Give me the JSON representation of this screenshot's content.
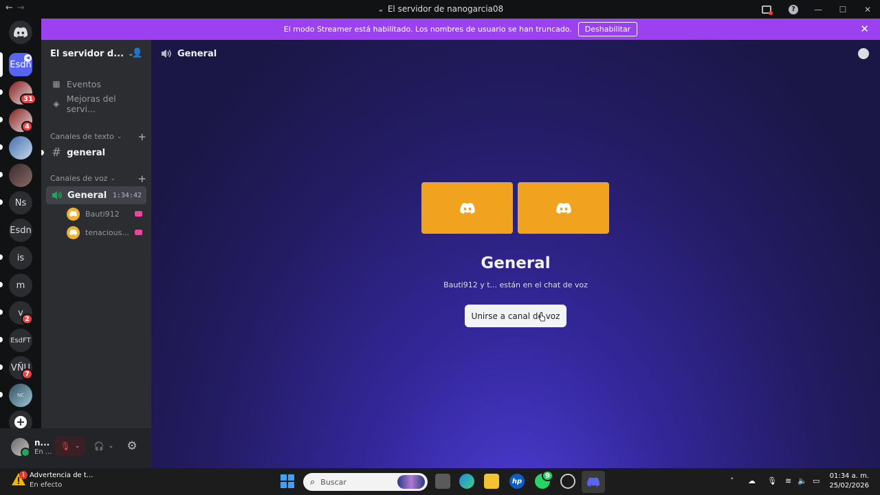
{
  "window": {
    "title": "El servidor de nanogarcia08",
    "back_icon": "←",
    "forward_icon": "→",
    "controls": [
      "—",
      "☐",
      "✕"
    ]
  },
  "banner": {
    "text": "El modo Streamer está habilitado. Los nombres de usuario se han truncado.",
    "button": "Deshabilitar",
    "close": "✕",
    "color": "#9b41f0"
  },
  "guilds": {
    "selected": "Esdn",
    "items": [
      {
        "label": "",
        "badge": "31"
      },
      {
        "label": "",
        "badge": "4"
      },
      {
        "label": "",
        "badge": ""
      },
      {
        "label": "",
        "badge": ""
      },
      {
        "label": "Ns",
        "badge": ""
      },
      {
        "label": "Esdn",
        "badge": ""
      },
      {
        "label": "is",
        "badge": ""
      },
      {
        "label": "m",
        "badge": ""
      },
      {
        "label": "v",
        "badge": "2"
      },
      {
        "label": "EsdFT",
        "badge": ""
      },
      {
        "label": "VÑU",
        "badge": "7"
      },
      {
        "label": "NC",
        "badge": ""
      }
    ],
    "add": "+"
  },
  "sidebar": {
    "server_name": "El servidor d...",
    "items": [
      {
        "label": "Eventos"
      },
      {
        "label": "Mejoras del servi..."
      }
    ],
    "text_category": "Canales de texto",
    "voice_category": "Canales de voz",
    "text_channel": "general",
    "voice_channel": "General",
    "voice_timer": "1:34:42",
    "voice_users": [
      "Bauti912",
      "tenacious..."
    ]
  },
  "user_panel": {
    "name": "n...",
    "status": "En ..."
  },
  "main": {
    "channel": "General",
    "title": "General",
    "subtitle": "Bauti912 y t... están en el chat de voz",
    "join_button": "Unirse a canal de voz",
    "tile_color": "#f0a31f"
  },
  "taskbar": {
    "warning_title": "Advertencia de t...",
    "warning_sub": "En efecto",
    "warning_badge": "1",
    "search_placeholder": "Buscar",
    "whatsapp_badge": "9",
    "time": "01:34 a. m.",
    "date": "25/02/2026"
  }
}
